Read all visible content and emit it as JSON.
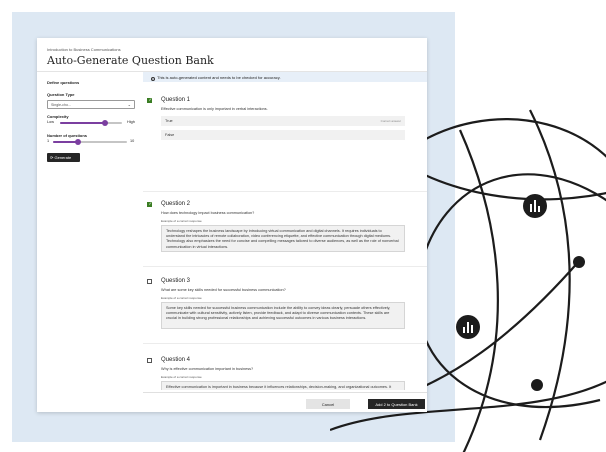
{
  "breadcrumb": "Introduction to Business Communications",
  "page_title": "Auto-Generate Question Bank",
  "left_panel": {
    "define_label": "Define questions",
    "question_type_label": "Question Type",
    "question_type_value": "Single-cho...",
    "complexity_label": "Complexity",
    "complexity_low": "Low",
    "complexity_high": "High",
    "complexity_level_pct": 72,
    "num_questions_label": "Number of questions",
    "num_min": "1",
    "num_max": "10",
    "num_value": 4,
    "generate_label": "Generate",
    "generate_icon": "refresh-icon"
  },
  "banner": {
    "icon": "info-icon",
    "text": "This is auto-generated content and needs to be checked for accuracy."
  },
  "questions": [
    {
      "title": "Question 1",
      "checked": true,
      "text": "Effective communication is only important in verbal interactions.",
      "options": [
        {
          "label": "True",
          "tag": "Correct answer"
        },
        {
          "label": "False",
          "tag": ""
        }
      ]
    },
    {
      "title": "Question 2",
      "checked": true,
      "text": "How does technology impact business communication?",
      "example_label": "Example of a correct response",
      "answer": "Technology reshapes the business landscape by introducing virtual communication and digital channels. It requires individuals to understand the intricacies of remote collaboration, video conferencing etiquette, and effective communication through digital mediums. Technology also emphasizes the need for concise and compelling messages tailored to diverse audiences, as well as the role of nonverbal communication in virtual interactions."
    },
    {
      "title": "Question 3",
      "checked": false,
      "text": "What are some key skills needed for successful business communication?",
      "example_label": "Example of a correct response",
      "answer": "Some key skills needed for successful business communication include the ability to convey ideas clearly, persuade others effectively, communicate with cultural sensitivity, actively listen, provide feedback, and adapt to diverse communication contexts. These skills are crucial in building strong professional relationships and achieving successful outcomes in various business interactions."
    },
    {
      "title": "Question 4",
      "checked": false,
      "text": "Why is effective communication important in business?",
      "example_label": "Example of a correct response",
      "answer": "Effective communication is important in business because it influences relationships, decision-making, and organizational outcomes. It allows individuals to convey ideas clearly, persuasively, and with cultural sensitivity, which is essential in comprising emails, participating in meetings, delivering presentations, and collaborating within a team."
    }
  ],
  "footer": {
    "cancel_label": "Cancel",
    "add_label": "Add 2 to Question Bank"
  },
  "colors": {
    "accent": "#7b3fa0",
    "check": "#3a7d23",
    "backdrop": "#dde8f3",
    "dark_button": "#262626"
  }
}
